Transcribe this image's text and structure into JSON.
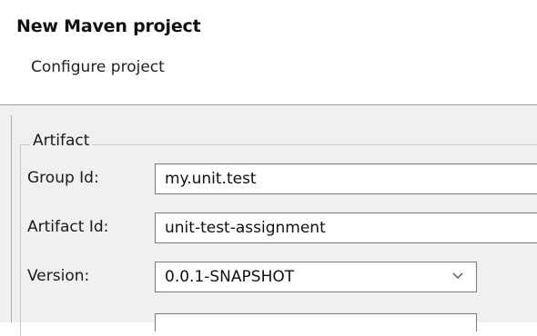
{
  "dialog": {
    "title": "New Maven project",
    "subtitle": "Configure project"
  },
  "artifact_group": {
    "legend": "Artifact",
    "group_id": {
      "label": "Group Id:",
      "value": "my.unit.test"
    },
    "artifact_id": {
      "label": "Artifact Id:",
      "value": "unit-test-assignment"
    },
    "version": {
      "label": "Version:",
      "value": "0.0.1-SNAPSHOT"
    }
  },
  "icons": {
    "dropdown": "chevron-down-icon"
  }
}
